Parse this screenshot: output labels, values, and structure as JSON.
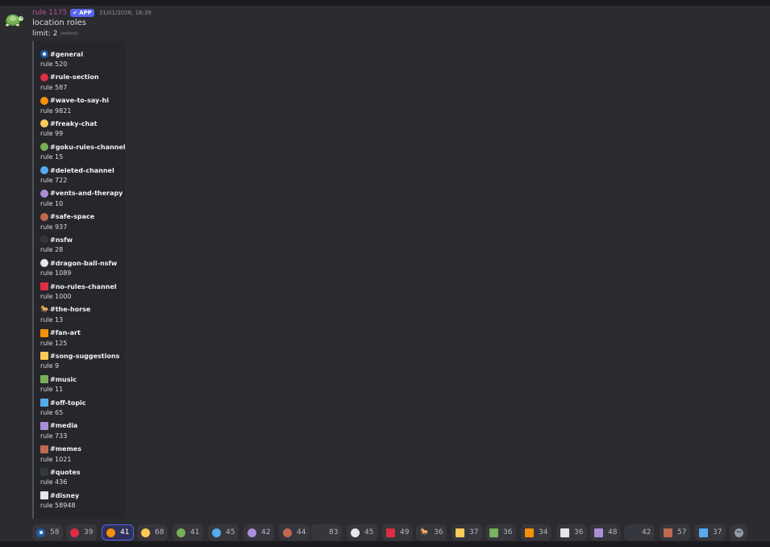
{
  "colors": {
    "blue_dark": "#1e5ea8",
    "red": "#dd2e44",
    "orange": "#f4900c",
    "yellow": "#fdcb58",
    "green": "#78b159",
    "blue": "#55acee",
    "purple": "#aa8ed6",
    "brown": "#c1694f",
    "black": "#31373d",
    "white": "#e6e7e8",
    "horse": "#c25b3c"
  },
  "message": {
    "author": "rule 1175",
    "app_badge": "APP",
    "timestamp": "31/01/2026, 16:39",
    "content_line1": "location roles",
    "content_line2": "limit: 2",
    "edited_label": "(edited)",
    "avatar_icon": "turtle-icon"
  },
  "embed": {
    "entries": [
      {
        "channel": "#general",
        "rule": "rule 520",
        "icon": "blue-circle-target",
        "shape": "circle",
        "color": "#1e5ea8"
      },
      {
        "channel": "#rule-section",
        "rule": "rule 587",
        "icon": "red-circle",
        "shape": "circle",
        "color": "#dd2e44"
      },
      {
        "channel": "#wave-to-say-hi",
        "rule": "rule 9821",
        "icon": "orange-circle",
        "shape": "circle",
        "color": "#f4900c"
      },
      {
        "channel": "#freaky-chat",
        "rule": "rule 99",
        "icon": "yellow-circle",
        "shape": "circle",
        "color": "#fdcb58"
      },
      {
        "channel": "#goku-rules-channel",
        "rule": "rule 15",
        "icon": "green-circle",
        "shape": "circle",
        "color": "#78b159"
      },
      {
        "channel": "#deleted-channel",
        "rule": "rule 722",
        "icon": "blue-circle",
        "shape": "circle",
        "color": "#55acee"
      },
      {
        "channel": "#vents-and-therapy",
        "rule": "rule 10",
        "icon": "purple-circle",
        "shape": "circle",
        "color": "#aa8ed6"
      },
      {
        "channel": "#safe-space",
        "rule": "rule 937",
        "icon": "brown-circle",
        "shape": "circle",
        "color": "#c1694f"
      },
      {
        "channel": "#nsfw",
        "rule": "rule 28",
        "icon": "black-circle",
        "shape": "circle",
        "color": "#31373d"
      },
      {
        "channel": "#dragon-ball-nsfw",
        "rule": "rule 1089",
        "icon": "white-circle",
        "shape": "circle",
        "color": "#e6e7e8"
      },
      {
        "channel": "#no-rules-channel",
        "rule": "rule 1000",
        "icon": "red-square",
        "shape": "square",
        "color": "#dd2e44"
      },
      {
        "channel": "#the-horse",
        "rule": "rule 13",
        "icon": "horse-icon",
        "shape": "horse",
        "color": "#c25b3c"
      },
      {
        "channel": "#fan-art",
        "rule": "rule 125",
        "icon": "orange-square",
        "shape": "square",
        "color": "#f4900c"
      },
      {
        "channel": "#song-suggestions",
        "rule": "rule 9",
        "icon": "yellow-square",
        "shape": "square",
        "color": "#fdcb58"
      },
      {
        "channel": "#music",
        "rule": "rule 11",
        "icon": "green-square",
        "shape": "square",
        "color": "#78b159"
      },
      {
        "channel": "#off-topic",
        "rule": "rule 65",
        "icon": "blue-square",
        "shape": "square",
        "color": "#55acee"
      },
      {
        "channel": "#media",
        "rule": "rule 733",
        "icon": "purple-square",
        "shape": "square",
        "color": "#aa8ed6"
      },
      {
        "channel": "#memes",
        "rule": "rule 1021",
        "icon": "brown-square",
        "shape": "square",
        "color": "#c1694f"
      },
      {
        "channel": "#quotes",
        "rule": "rule 436",
        "icon": "black-square",
        "shape": "square",
        "color": "#31373d"
      },
      {
        "channel": "#disney",
        "rule": "rule 58948",
        "icon": "white-square",
        "shape": "square",
        "color": "#e6e7e8"
      }
    ]
  },
  "reactions": [
    {
      "count": "58",
      "icon": "blue-circle-target",
      "shape": "circle",
      "color": "#1e5ea8",
      "active": false
    },
    {
      "count": "39",
      "icon": "red-circle",
      "shape": "circle",
      "color": "#dd2e44",
      "active": false
    },
    {
      "count": "41",
      "icon": "orange-circle",
      "shape": "circle",
      "color": "#f4900c",
      "active": true
    },
    {
      "count": "68",
      "icon": "yellow-circle",
      "shape": "circle",
      "color": "#fdcb58",
      "active": false
    },
    {
      "count": "41",
      "icon": "green-circle",
      "shape": "circle",
      "color": "#78b159",
      "active": false
    },
    {
      "count": "45",
      "icon": "blue-circle",
      "shape": "circle",
      "color": "#55acee",
      "active": false
    },
    {
      "count": "42",
      "icon": "purple-circle",
      "shape": "circle",
      "color": "#aa8ed6",
      "active": false
    },
    {
      "count": "44",
      "icon": "brown-circle",
      "shape": "circle",
      "color": "#c1694f",
      "active": false
    },
    {
      "count": "83",
      "icon": "black-circle",
      "shape": "circle",
      "color": "#31373d",
      "active": false
    },
    {
      "count": "45",
      "icon": "white-circle",
      "shape": "circle",
      "color": "#e6e7e8",
      "active": false
    },
    {
      "count": "49",
      "icon": "red-square",
      "shape": "square",
      "color": "#dd2e44",
      "active": false
    },
    {
      "count": "36",
      "icon": "horse-icon",
      "shape": "horse",
      "color": "#c25b3c",
      "active": false
    },
    {
      "count": "37",
      "icon": "yellow-square",
      "shape": "square",
      "color": "#fdcb58",
      "active": false
    },
    {
      "count": "36",
      "icon": "green-square",
      "shape": "square",
      "color": "#78b159",
      "active": false
    },
    {
      "count": "34",
      "icon": "orange-square",
      "shape": "square",
      "color": "#f4900c",
      "active": false
    },
    {
      "count": "36",
      "icon": "white-square",
      "shape": "square",
      "color": "#e6e7e8",
      "active": false
    },
    {
      "count": "48",
      "icon": "purple-square",
      "shape": "square",
      "color": "#aa8ed6",
      "active": false
    },
    {
      "count": "42",
      "icon": "black-square",
      "shape": "square",
      "color": "#31373d",
      "active": false
    },
    {
      "count": "57",
      "icon": "brown-square",
      "shape": "square",
      "color": "#c1694f",
      "active": false
    },
    {
      "count": "37",
      "icon": "blue-square",
      "shape": "square",
      "color": "#55acee",
      "active": false
    }
  ],
  "add_reaction_icon": "add-reaction-icon"
}
